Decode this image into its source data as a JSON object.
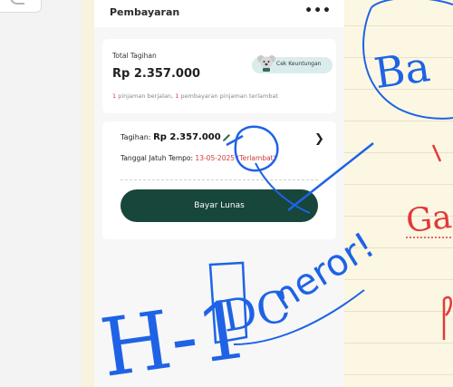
{
  "header": {
    "title": "Pembayaran",
    "more_icon": "more-horizontal-icon"
  },
  "summary": {
    "total_label": "Total Tagihan",
    "total_amount": "Rp 2.357.000",
    "cek_button": "Cek Keuntungan",
    "active_count": "1",
    "active_text": " pinjaman berjalan,",
    "late_count": "1",
    "late_text": " pembayaran pinjaman terlambat"
  },
  "bill": {
    "tagihan_label": "Tagihan:",
    "tagihan_amount": "Rp 2.357.000",
    "due_label": "Tanggal Jatuh Tempo:",
    "due_date": "13-05-2025",
    "due_status": "(Terlambat)"
  },
  "pay_button": "Bayar Lunas",
  "annotations": {
    "note_left": "H-1",
    "note_dc": "DC",
    "note_word": "neror!",
    "right_top": "Ba",
    "right_mid": "Ga"
  },
  "colors": {
    "primary": "#17463a",
    "danger": "#d03b3b",
    "ink": "#1e63e6",
    "red_ink": "#e23a3a",
    "paper": "#fbf7e3"
  }
}
